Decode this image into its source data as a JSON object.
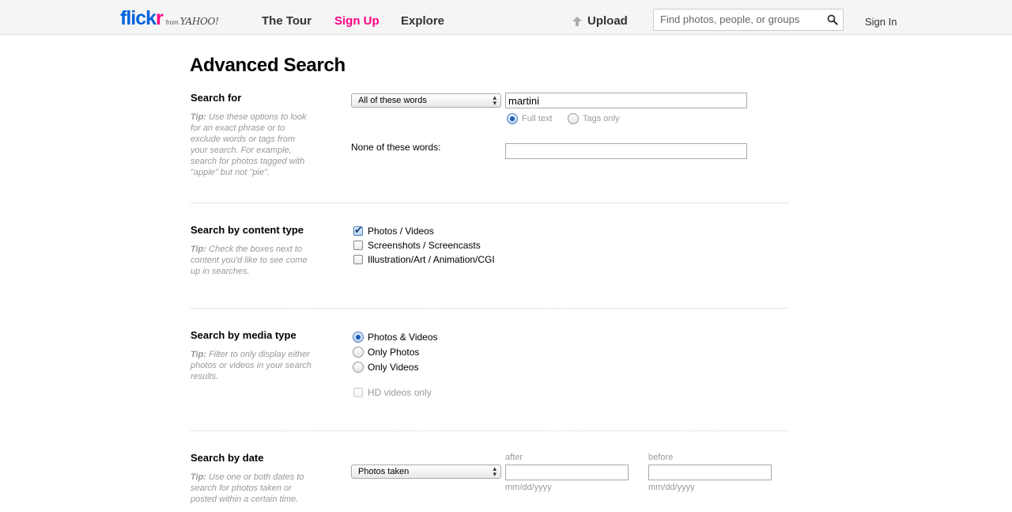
{
  "header": {
    "logo_flick": "flick",
    "logo_r": "r",
    "logo_from": "from",
    "logo_yahoo": "YAHOO!",
    "nav_tour": "The Tour",
    "nav_signup": "Sign Up",
    "nav_explore": "Explore",
    "upload": "Upload",
    "search_placeholder": "Find photos, people, or groups",
    "signin": "Sign In",
    "brand_colors": {
      "blue": "#0063dc",
      "pink": "#ff0084"
    }
  },
  "page_title": "Advanced Search",
  "search_for": {
    "title": "Search for",
    "tip_label": "Tip:",
    "tip_text": " Use these options to look for an exact phrase or to exclude words or tags from your search. For example, search for photos tagged with \"apple\" but not \"pie\".",
    "mode_select": "All of these words",
    "query_value": "martini",
    "scope_options": [
      {
        "label": "Full text",
        "selected": true
      },
      {
        "label": "Tags only",
        "selected": false
      }
    ],
    "none_label": "None of these words:",
    "none_value": ""
  },
  "content_type": {
    "title": "Search by content type",
    "tip_label": "Tip:",
    "tip_text": " Check the boxes next to content you'd like to see come up in searches.",
    "options": [
      {
        "label": "Photos / Videos",
        "checked": true
      },
      {
        "label": "Screenshots / Screencasts",
        "checked": false
      },
      {
        "label": "Illustration/Art / Animation/CGI",
        "checked": false
      }
    ]
  },
  "media_type": {
    "title": "Search by media type",
    "tip_label": "Tip:",
    "tip_text": " Filter to only display either photos or videos in your search results.",
    "options": [
      {
        "label": "Photos & Videos",
        "selected": true
      },
      {
        "label": "Only Photos",
        "selected": false
      },
      {
        "label": "Only Videos",
        "selected": false
      }
    ],
    "hd_label": "HD videos only",
    "hd_checked": false
  },
  "date": {
    "title": "Search by date",
    "tip_label": "Tip:",
    "tip_text": " Use one or both dates to search for photos taken or posted within a certain time.",
    "mode_select": "Photos taken",
    "after_label": "after",
    "before_label": "before",
    "after_value": "",
    "before_value": "",
    "format_hint": "mm/dd/yyyy"
  }
}
